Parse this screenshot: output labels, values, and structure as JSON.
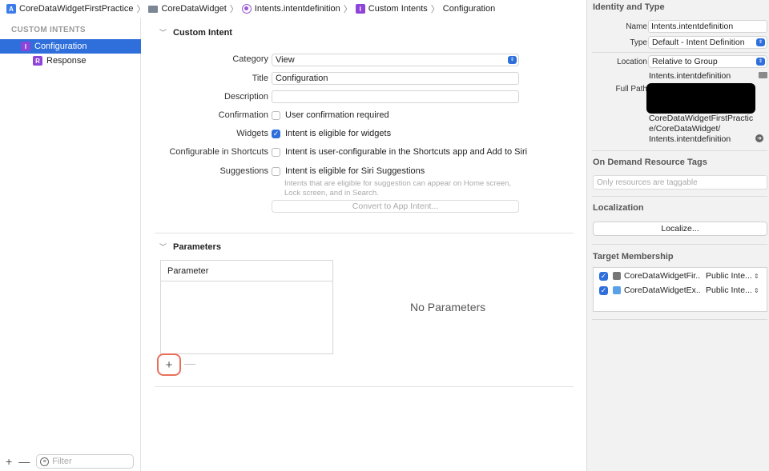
{
  "breadcrumb": {
    "items": [
      "CoreDataWidgetFirstPractice",
      "CoreDataWidget",
      "Intents.intentdefinition",
      "Custom Intents",
      "Configuration"
    ]
  },
  "sidebar": {
    "header": "CUSTOM INTENTS",
    "items": [
      {
        "label": "Configuration",
        "badge": "I",
        "selected": true
      },
      {
        "label": "Response",
        "badge": "R",
        "selected": false
      }
    ],
    "filter_placeholder": "Filter",
    "add_label": "+",
    "remove_label": "—"
  },
  "editor": {
    "custom_intent_title": "Custom Intent",
    "category_label": "Category",
    "category_value": "View",
    "title_label": "Title",
    "title_value": "Configuration",
    "description_label": "Description",
    "description_value": "",
    "confirmation_label": "Confirmation",
    "confirmation_text": "User confirmation required",
    "confirmation_checked": false,
    "widgets_label": "Widgets",
    "widgets_text": "Intent is eligible for widgets",
    "widgets_checked": true,
    "configurable_label": "Configurable in Shortcuts",
    "configurable_text": "Intent is user-configurable in the Shortcuts app and Add to Siri",
    "configurable_checked": false,
    "suggestions_label": "Suggestions",
    "suggestions_text": "Intent is eligible for Siri Suggestions",
    "suggestions_checked": false,
    "suggestions_hint": "Intents that are eligible for suggestion can appear on Home screen, Lock screen, and in Search.",
    "convert_button": "Convert to App Intent...",
    "parameters_title": "Parameters",
    "parameter_column": "Parameter",
    "no_parameters": "No Parameters",
    "add_param": "+",
    "remove_param": "—"
  },
  "inspector": {
    "identity_title": "Identity and Type",
    "name_label": "Name",
    "name_value": "Intents.intentdefinition",
    "type_label": "Type",
    "type_value": "Default - Intent Definition",
    "location_label": "Location",
    "location_value": "Relative to Group",
    "location_file": "Intents.intentdefinition",
    "full_path_label": "Full Path",
    "full_path_lines": [
      "CoreDataWidgetFirstPractic",
      "e/CoreDataWidget/",
      "Intents.intentdefinition"
    ],
    "on_demand_title": "On Demand Resource Tags",
    "tags_placeholder": "Only resources are taggable",
    "localization_title": "Localization",
    "localize_button": "Localize...",
    "target_title": "Target Membership",
    "targets": [
      {
        "name": "CoreDataWidgetFir...",
        "visibility": "Public Inte...",
        "checked": true,
        "icon": "app-icon"
      },
      {
        "name": "CoreDataWidgetEx...",
        "visibility": "Public Inte...",
        "checked": true,
        "icon": "extension-icon"
      }
    ]
  },
  "colors": {
    "accent": "#2f6fdc",
    "highlight_ring": "#e8705a",
    "intent_purple": "#8e44d8"
  }
}
